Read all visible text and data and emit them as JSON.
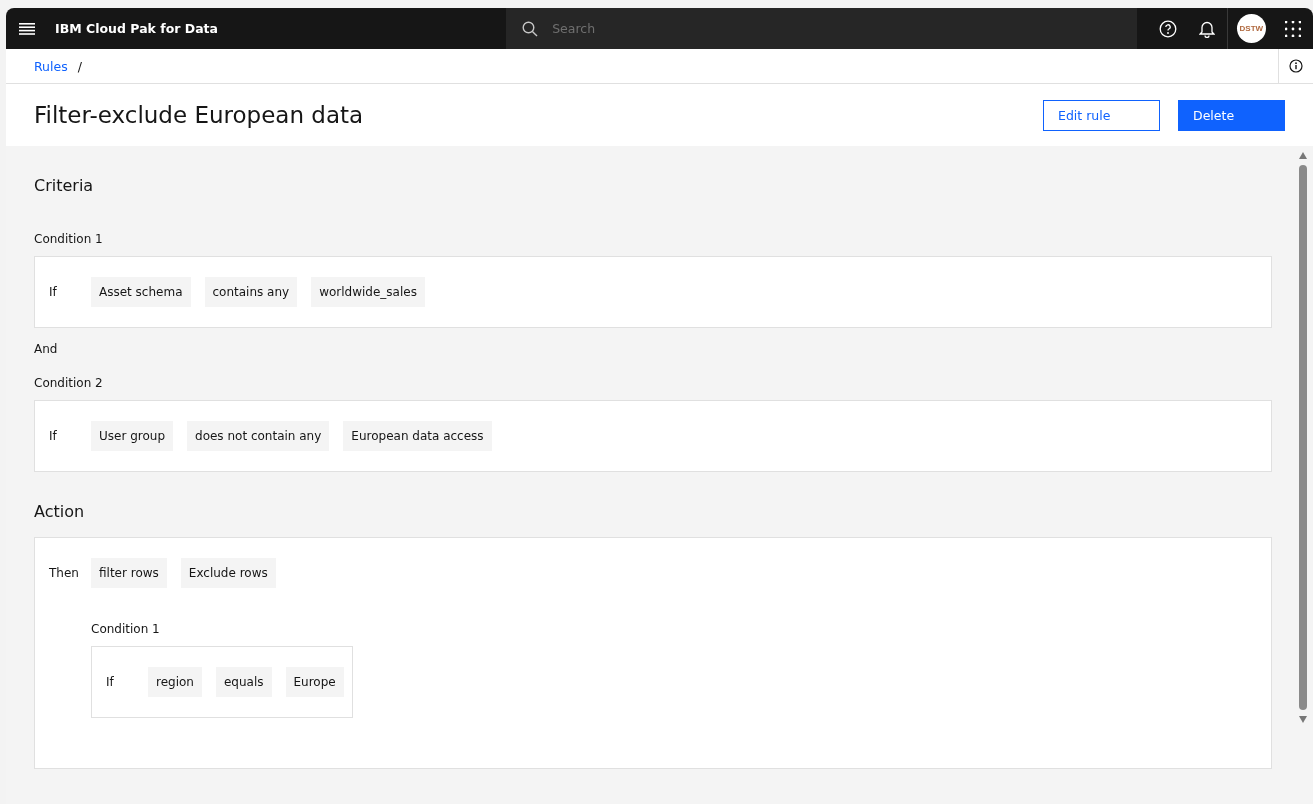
{
  "header": {
    "product": "IBM Cloud Pak for Data",
    "search": {
      "placeholder": "Search"
    },
    "avatar": "DSTW"
  },
  "breadcrumb": {
    "items": [
      {
        "label": "Rules"
      }
    ],
    "separator": "/"
  },
  "title": "Filter-exclude European data",
  "buttons": [
    {
      "label": "Edit rule",
      "kind": "secondary"
    },
    {
      "label": "Delete",
      "kind": "primary"
    }
  ],
  "criteria": {
    "heading": "Criteria",
    "items": [
      {
        "kind": "condition",
        "label": "Condition 1",
        "keyword": "If",
        "tokens": [
          "Asset schema",
          "contains any",
          "worldwide_sales"
        ]
      },
      {
        "kind": "joiner",
        "label": "And"
      },
      {
        "kind": "condition",
        "label": "Condition 2",
        "keyword": "If",
        "tokens": [
          "User group",
          "does not contain any",
          "European data access"
        ]
      }
    ]
  },
  "action": {
    "heading": "Action",
    "keyword": "Then",
    "tokens": [
      "filter rows",
      "Exclude rows"
    ],
    "condition": {
      "label": "Condition 1",
      "keyword": "If",
      "tokens": [
        "region",
        "equals",
        "Europe"
      ]
    }
  }
}
